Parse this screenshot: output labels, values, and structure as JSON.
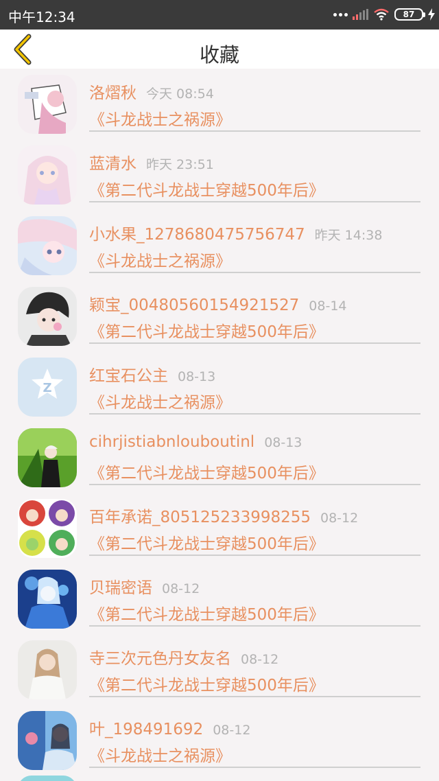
{
  "status_bar": {
    "time": "中午12:34",
    "battery": "87"
  },
  "header": {
    "title": "收藏"
  },
  "favorites": [
    {
      "name": "洛熠秋",
      "time": "今天 08:54",
      "book": "《斗龙战士之祸源》"
    },
    {
      "name": "蓝清水",
      "time": "昨天 23:51",
      "book": "《第二代斗龙战士穿越500年后》"
    },
    {
      "name": "小水果_1278680475756747",
      "time": "昨天 14:38",
      "book": "《斗龙战士之祸源》"
    },
    {
      "name": "颖宝_00480560154921527",
      "time": "08-14",
      "book": "《第二代斗龙战士穿越500年后》"
    },
    {
      "name": "红宝石公主",
      "time": "08-13",
      "book": "《斗龙战士之祸源》"
    },
    {
      "name": "cihrjistiabnlouboutinl",
      "time": "08-13",
      "book": "《第二代斗龙战士穿越500年后》"
    },
    {
      "name": "百年承诺_805125233998255",
      "time": "08-12",
      "book": "《第二代斗龙战士穿越500年后》"
    },
    {
      "name": "贝瑞密语",
      "time": "08-12",
      "book": "《第二代斗龙战士穿越500年后》"
    },
    {
      "name": "寺三次元色丹女友名",
      "time": "08-12",
      "book": "《第二代斗龙战士穿越500年后》"
    },
    {
      "name": "叶_198491692",
      "time": "08-12",
      "book": "《斗龙战士之祸源》"
    }
  ],
  "colors": {
    "accent": "#e89060",
    "time": "#b3b3b3",
    "header_bg": "#ffffff",
    "status_bg": "#3a3a3a"
  }
}
